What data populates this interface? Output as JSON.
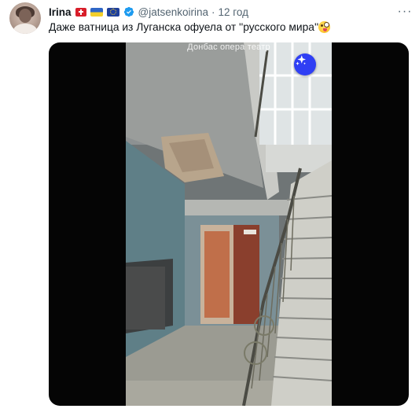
{
  "tweet": {
    "display_name": "Irina",
    "handle": "@jatsenkoirina",
    "separator": "·",
    "time": "12 год",
    "text": "Даже ватница из Луганска офуела от ''русского мира''",
    "emoji_icon": "zany-face-emoji",
    "more_label": "···",
    "badges": [
      "swiss-flag-icon",
      "ukraine-flag-icon",
      "eu-flag-icon",
      "verified-badge-icon"
    ]
  },
  "media": {
    "caption": "Донбас опера театр",
    "action_icon": "sparkles-icon"
  },
  "colors": {
    "handle_gray": "#536471",
    "verified_blue": "#1d9bf0",
    "sparkle_button_blue": "#2f3ff4",
    "video_background": "#050505"
  }
}
